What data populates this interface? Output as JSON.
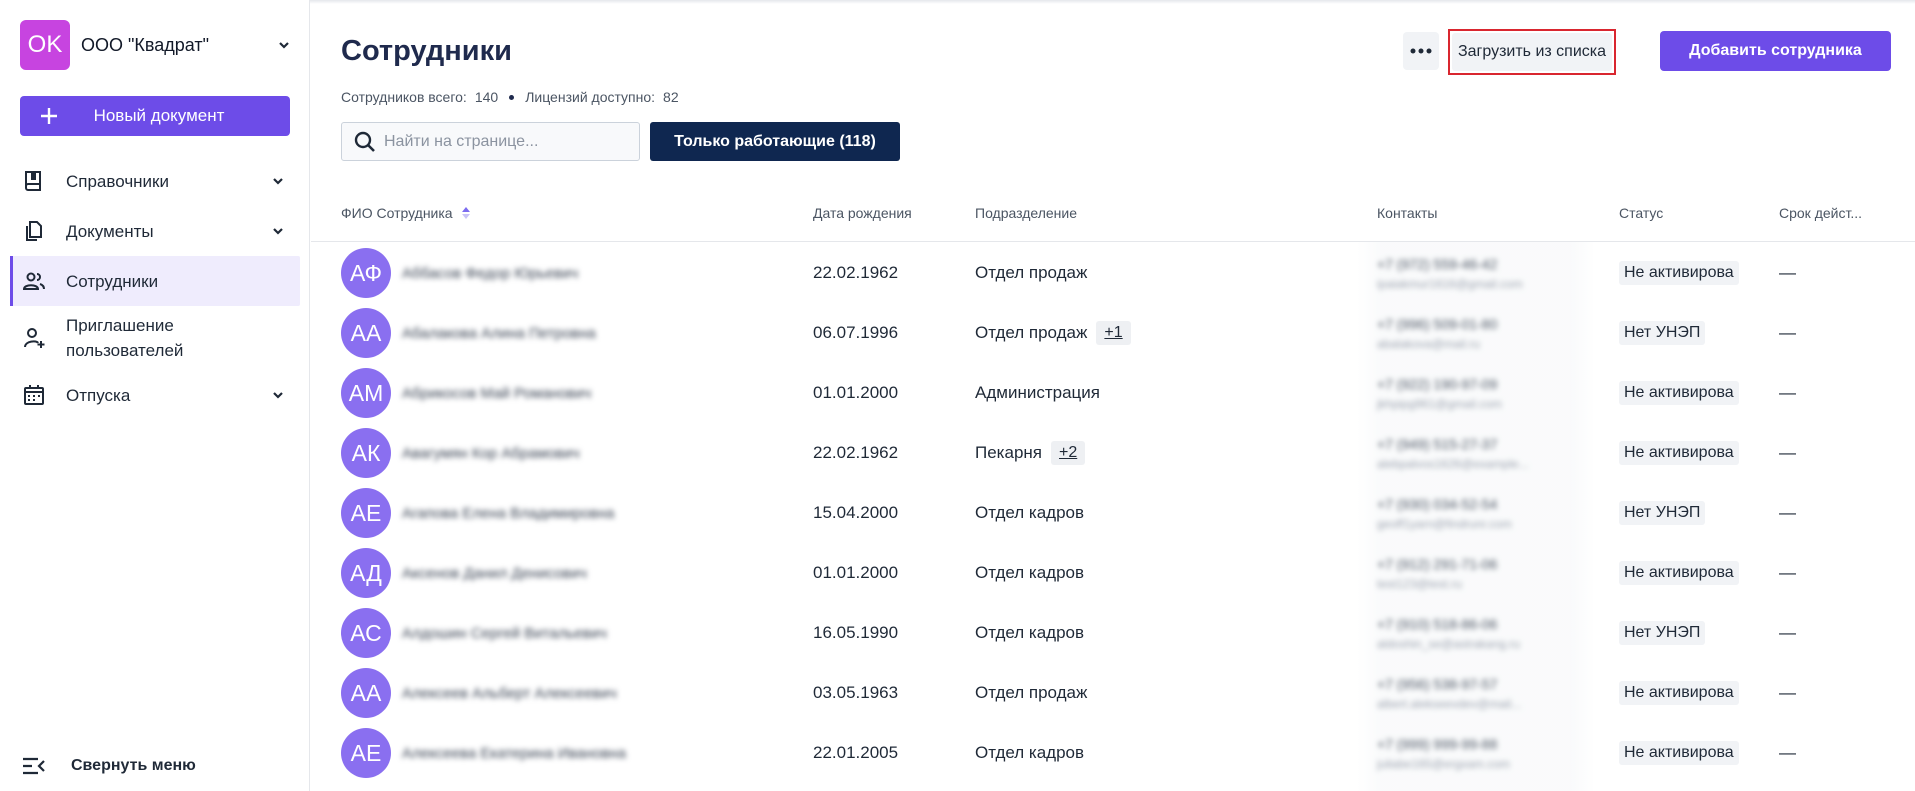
{
  "org": {
    "initials": "OK",
    "name": "ООО \"Квадрат\""
  },
  "sidebar": {
    "new_document": "Новый документ",
    "items": [
      {
        "label": "Справочники",
        "icon": "book-icon",
        "has_chevron": true
      },
      {
        "label": "Документы",
        "icon": "documents-icon",
        "has_chevron": true
      },
      {
        "label": "Сотрудники",
        "icon": "people-icon",
        "has_chevron": false,
        "active": true
      },
      {
        "label": "Приглашение пользователей",
        "icon": "user-plus-icon",
        "has_chevron": false
      },
      {
        "label": "Отпуска",
        "icon": "calendar-icon",
        "has_chevron": true
      }
    ],
    "collapse_label": "Свернуть меню"
  },
  "header": {
    "title": "Сотрудники",
    "total_label": "Сотрудников всего:",
    "total_value": "140",
    "licenses_label": "Лицензий доступно:",
    "licenses_value": "82",
    "load_label": "Загрузить из списка",
    "add_label": "Добавить сотрудника"
  },
  "search": {
    "placeholder": "Найти на странице...",
    "value": ""
  },
  "filter": {
    "label": "Только работающие (118)"
  },
  "table": {
    "columns": [
      "ФИО Сотрудника",
      "Дата рождения",
      "Подразделение",
      "Контакты",
      "Статус",
      "Срок дейст..."
    ],
    "rows": [
      {
        "initials": "АФ",
        "name": "Аббасов Федор Юрьевич",
        "birth": "22.02.1962",
        "dept": "Отдел продаж",
        "extra": "",
        "phone": "+7 (972) 559-46-42",
        "email": "ipaiakmur1616@gmail.com",
        "status": "Не активирова",
        "term": "—"
      },
      {
        "initials": "АА",
        "name": "Абалакова Алина Петровна",
        "birth": "06.07.1996",
        "dept": "Отдел продаж",
        "extra": "+1",
        "phone": "+7 (996) 509-01-80",
        "email": "abalakova@mail.ru",
        "status": "Нет УНЭП",
        "term": "—"
      },
      {
        "initials": "АМ",
        "name": "Абрикосов Май Романович",
        "birth": "01.01.2000",
        "dept": "Администрация",
        "extra": "",
        "phone": "+7 (922) 190-97-09",
        "email": "jkhpipg961@gmail.com",
        "status": "Не активирова",
        "term": "—"
      },
      {
        "initials": "АК",
        "name": "Авагумян Кор Абрамович",
        "birth": "22.02.1962",
        "dept": "Пекарня",
        "extra": "+2",
        "phone": "+7 (949) 515-27-37",
        "email": "alebpalvos1626@example...",
        "status": "Не активирова",
        "term": "—"
      },
      {
        "initials": "АЕ",
        "name": "Агапова Елена Владимировна",
        "birth": "15.04.2000",
        "dept": "Отдел кадров",
        "extra": "",
        "phone": "+7 (930) 034-52-54",
        "email": "geoff1yarn@findrunr.com",
        "status": "Нет УНЭП",
        "term": "—"
      },
      {
        "initials": "АД",
        "name": "Аксенов Данил Денисович",
        "birth": "01.01.2000",
        "dept": "Отдел кадров",
        "extra": "",
        "phone": "+7 (912) 291-71-06",
        "email": "test123@test.ru",
        "status": "Не активирова",
        "term": "—"
      },
      {
        "initials": "АС",
        "name": "Алдошин Сергей Витальевич",
        "birth": "16.05.1990",
        "dept": "Отдел кадров",
        "extra": "",
        "phone": "+7 (910) 518-86-06",
        "email": "aldoshin_se@astrakang.ru",
        "status": "Нет УНЭП",
        "term": "—"
      },
      {
        "initials": "АА",
        "name": "Алексеев Альберт Алексеевич",
        "birth": "03.05.1963",
        "dept": "Отдел продаж",
        "extra": "",
        "phone": "+7 (956) 538-97-57",
        "email": "albert.alekseevdev@mail...",
        "status": "Не активирова",
        "term": "—"
      },
      {
        "initials": "АЕ",
        "name": "Алексеева Екатерина Ивановна",
        "birth": "22.01.2005",
        "dept": "Отдел кадров",
        "extra": "",
        "phone": "+7 (999) 999-99-88",
        "email": "juliabe165@ergxam.com",
        "status": "Не активирова",
        "term": "—"
      }
    ]
  },
  "colors": {
    "accent": "#6d4ce8",
    "navy": "#0f2750",
    "avatar_org": "#c744e0",
    "avatar_user": "#8a6ff0",
    "highlight": "#d9262f"
  }
}
